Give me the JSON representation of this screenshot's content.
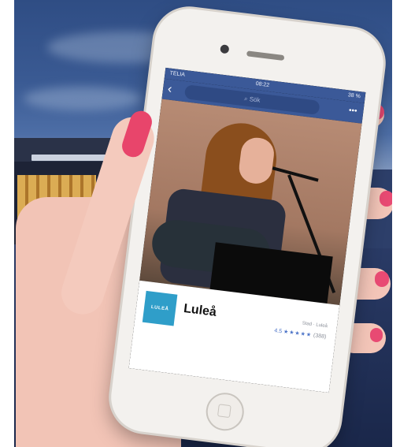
{
  "status_bar": {
    "carrier": "TELIA",
    "time": "08:22",
    "battery": "38 %"
  },
  "fb_header": {
    "back_icon": "chevron-left-icon",
    "search_placeholder": "Sök",
    "more_icon": "ellipsis-icon"
  },
  "page_card": {
    "logo_text": "LULEÅ",
    "title": "Luleå",
    "subtitle": "Stad · Luleå",
    "rating_value": "4.5",
    "rating_stars": "★★★★★",
    "rating_count": "(388)"
  },
  "colors": {
    "facebook_blue": "#3b5998",
    "nail_pink": "#e84a73",
    "logo_blue": "#2f9ec9"
  }
}
